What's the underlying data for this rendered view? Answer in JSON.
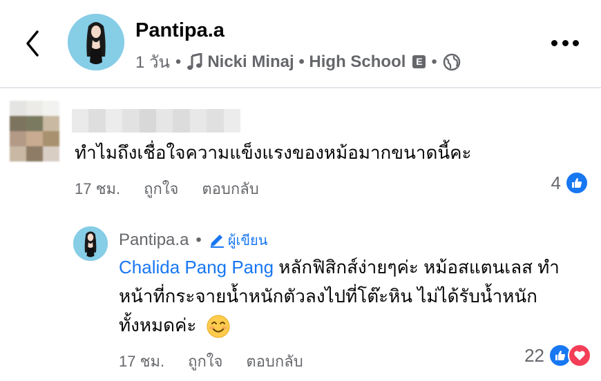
{
  "post": {
    "author": "Pantipa.a",
    "time": "1 วัน",
    "song": "Nicki Minaj • High School",
    "explicit_badge": "E",
    "separator": "•"
  },
  "comments": [
    {
      "text": "ทำไมถึงเชื่อใจความแข็งแรงของหม้อมากขนาดนี้คะ",
      "time": "17 ชม.",
      "like_label": "ถูกใจ",
      "reply_label": "ตอบกลับ",
      "reaction_count": "4"
    }
  ],
  "reply": {
    "author": "Pantipa.a",
    "separator": "•",
    "author_badge": "ผู้เขียน",
    "mention": "Chalida Pang Pang",
    "text": "หลักฟิสิกส์ง่ายๆค่ะ หม้อสแตนเลส ทำหน้าที่กระจายน้ำหนักตัวลงไปที่โต๊ะหิน ไม่ได้รับน้ำหนักทั้งหมดค่ะ",
    "time": "17 ชม.",
    "like_label": "ถูกใจ",
    "reply_label": "ตอบกลับ",
    "reaction_count": "22"
  },
  "icons": {
    "back": "chevron-left-icon",
    "more": "more-horizontal-icon",
    "music": "music-note-icon",
    "globe": "globe-icon",
    "like": "thumbs-up-icon",
    "heart": "heart-icon",
    "pencil": "pencil-icon",
    "emoji": "smiling-face-emoji"
  },
  "colors": {
    "link": "#1877f2",
    "like": "#1877f2",
    "heart": "#f33e58",
    "meta": "#65676b"
  }
}
